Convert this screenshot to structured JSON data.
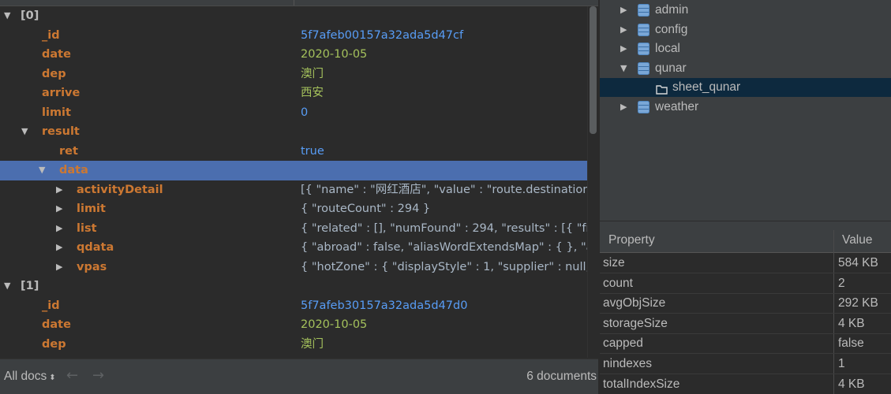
{
  "tree": [
    {
      "toggle": "open",
      "key": "[0]",
      "value": "",
      "kind": "idx",
      "level": 0
    },
    {
      "toggle": "",
      "key": "_id",
      "value": "5f7afeb00157a32ada5d47cf",
      "kind": "id",
      "level": 1
    },
    {
      "toggle": "",
      "key": "date",
      "value": "2020-10-05",
      "kind": "str",
      "level": 1
    },
    {
      "toggle": "",
      "key": "dep",
      "value": "澳门",
      "kind": "str",
      "level": 1
    },
    {
      "toggle": "",
      "key": "arrive",
      "value": "西安",
      "kind": "str",
      "level": 1
    },
    {
      "toggle": "",
      "key": "limit",
      "value": "0",
      "kind": "num",
      "level": 1
    },
    {
      "toggle": "open",
      "key": "result",
      "value": "",
      "kind": "key",
      "level": 1
    },
    {
      "toggle": "",
      "key": "ret",
      "value": "true",
      "kind": "bool",
      "level": 2
    },
    {
      "toggle": "open",
      "key": "data",
      "value": "",
      "kind": "key",
      "level": 2,
      "selected": true
    },
    {
      "toggle": "closed",
      "key": "activityDetail",
      "value": "[{ \"name\" : \"网红酒店\", \"value\" : \"route.destination",
      "kind": "obj",
      "level": 3
    },
    {
      "toggle": "closed",
      "key": "limit",
      "value": "{ \"routeCount\" : 294 }",
      "kind": "obj",
      "level": 3
    },
    {
      "toggle": "closed",
      "key": "list",
      "value": "{ \"related\" : [], \"numFound\" : 294, \"results\" : [{ \"fr",
      "kind": "obj",
      "level": 3
    },
    {
      "toggle": "closed",
      "key": "qdata",
      "value": "{ \"abroad\" : false, \"aliasWordExtendsMap\" : { }, \"a",
      "kind": "obj",
      "level": 3
    },
    {
      "toggle": "closed",
      "key": "vpas",
      "value": "{ \"hotZone\" : { \"displayStyle\" : 1, \"supplier\" : null,",
      "kind": "obj",
      "level": 3
    },
    {
      "toggle": "open",
      "key": "[1]",
      "value": "",
      "kind": "idx",
      "level": 0
    },
    {
      "toggle": "",
      "key": "_id",
      "value": "5f7afeb30157a32ada5d47d0",
      "kind": "id",
      "level": 1
    },
    {
      "toggle": "",
      "key": "date",
      "value": "2020-10-05",
      "kind": "str",
      "level": 1
    },
    {
      "toggle": "",
      "key": "dep",
      "value": "澳门",
      "kind": "str",
      "level": 1
    }
  ],
  "bottom": {
    "all_docs": "All docs",
    "doc_count": "6 documents"
  },
  "databases": [
    {
      "name": "admin",
      "open": false
    },
    {
      "name": "config",
      "open": false
    },
    {
      "name": "local",
      "open": false
    },
    {
      "name": "qunar",
      "open": true
    },
    {
      "name": "sheet_qunar",
      "collection": true,
      "selected": true
    },
    {
      "name": "weather",
      "open": false
    }
  ],
  "props": {
    "header_property": "Property",
    "header_value": "Value",
    "rows": [
      {
        "name": "size",
        "value": "584 KB"
      },
      {
        "name": "count",
        "value": "2"
      },
      {
        "name": "avgObjSize",
        "value": "292 KB"
      },
      {
        "name": "storageSize",
        "value": "4 KB"
      },
      {
        "name": "capped",
        "value": "false"
      },
      {
        "name": "nindexes",
        "value": "1"
      },
      {
        "name": "totalIndexSize",
        "value": "4 KB"
      }
    ]
  },
  "colors": {
    "selected_row": "#4b6eaf",
    "key": "#cc7832",
    "string": "#a5c25c",
    "number": "#589df6"
  }
}
